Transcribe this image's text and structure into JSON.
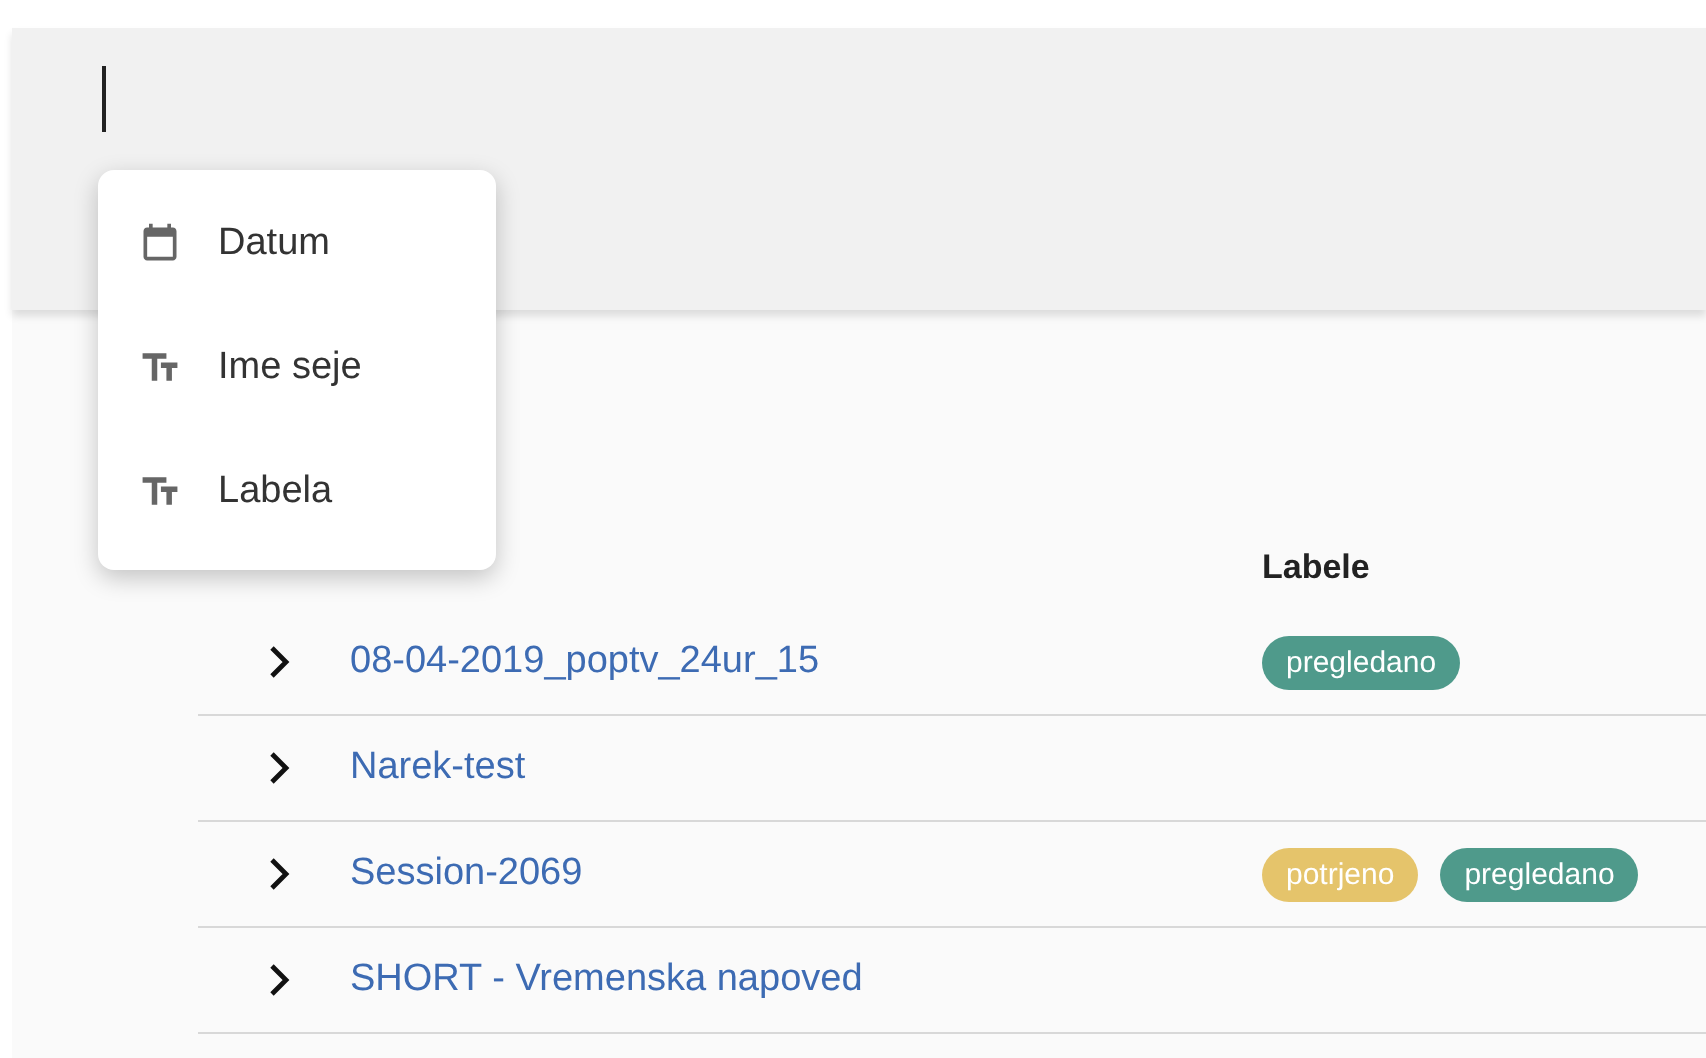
{
  "search": {
    "focused": true
  },
  "menu": {
    "items": [
      {
        "label": "Datum",
        "kind": "date"
      },
      {
        "label": "Ime seje",
        "kind": "text"
      },
      {
        "label": "Labela",
        "kind": "text"
      }
    ]
  },
  "table": {
    "columns": [
      "Labele"
    ],
    "rows": [
      {
        "name": "08-04-2019_poptv_24ur_15",
        "expanded": false,
        "labels": [
          {
            "text": "pregledano",
            "color": "#4f9a8b"
          }
        ]
      },
      {
        "name": "Narek-test",
        "expanded": false,
        "labels": []
      },
      {
        "name": "Session-2069",
        "expanded": false,
        "labels": [
          {
            "text": "potrjeno",
            "color": "#e5c46b"
          },
          {
            "text": "pregledano",
            "color": "#4f9a8b"
          }
        ]
      },
      {
        "name": "SHORT - Vremenska napoved",
        "expanded": false,
        "labels": []
      }
    ]
  }
}
